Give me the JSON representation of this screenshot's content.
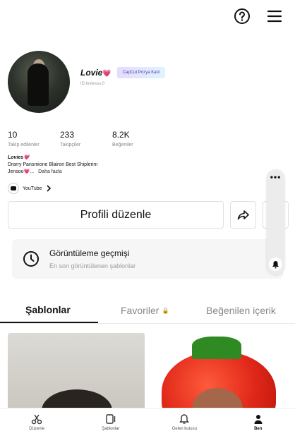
{
  "header": {
    "help_icon": "question-circle-icon",
    "menu_icon": "hamburger-menu-icon"
  },
  "profile": {
    "username": "Lovie",
    "username_emoji": "💗",
    "pro_badge": "CapCut Pro'ya Katıl",
    "user_id": "ID:loviesss.0",
    "stats": [
      {
        "value": "10",
        "label": "Takip edilenler"
      },
      {
        "value": "233",
        "label": "Takipçiler"
      },
      {
        "value": "8.2K",
        "label": "Beğeniler"
      }
    ],
    "bio": {
      "name": "Lovies💗",
      "line1": "Drarry Pansmione Blairon Best Shiplerim",
      "line2": "Jensoo💗...",
      "more": "Daha fazla"
    },
    "link_label": "YouTube",
    "edit_button": "Profili düzenle"
  },
  "history": {
    "title": "Görüntüleme geçmişi",
    "subtitle": "En son görüntülenen şablonlar"
  },
  "tabs": [
    {
      "label": "Şablonlar",
      "active": true
    },
    {
      "label": "Favoriler",
      "active": false,
      "locked": true
    },
    {
      "label": "Beğenilen içerik",
      "active": false
    }
  ],
  "bottom_nav": [
    {
      "label": "Düzenle",
      "icon": "scissors-icon"
    },
    {
      "label": "Şablonlar",
      "icon": "templates-icon"
    },
    {
      "label": "Gelen kutusu",
      "icon": "bell-icon"
    },
    {
      "label": "Ben",
      "icon": "person-icon",
      "active": true
    }
  ]
}
